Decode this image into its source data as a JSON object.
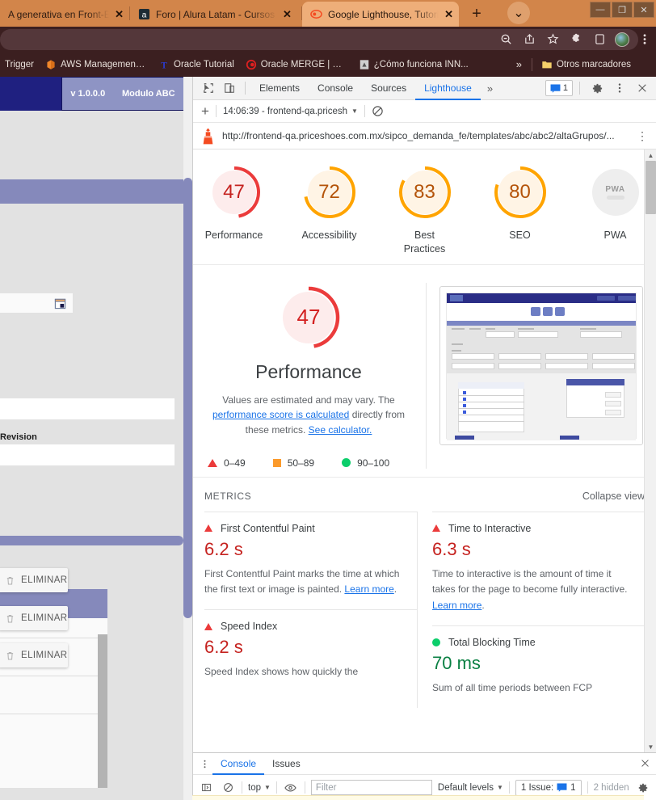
{
  "browser": {
    "tabs": [
      {
        "title": "A generativa en Front-End: tr",
        "icon": "none",
        "active": false
      },
      {
        "title": "Foro | Alura Latam - Cursos on",
        "icon": "alura-icon",
        "active": false
      },
      {
        "title": "Google Lighthouse, Tutorial Pa",
        "icon": "lighthouse-icon",
        "active": true
      }
    ],
    "new_tab_label": "+",
    "tab_search_label": "⌄",
    "window_controls": {
      "minimize": "—",
      "maximize": "❐",
      "close": "✕"
    },
    "toolbar_icons": [
      "zoom-out-icon",
      "share-icon",
      "bookmark-star-icon",
      "extensions-icon",
      "cast-icon",
      "profile-avatar",
      "chrome-menu-icon"
    ],
    "bookmarks": [
      {
        "label": "Trigger",
        "icon": "generic-icon"
      },
      {
        "label": "AWS Management Co...",
        "icon": "aws-icon"
      },
      {
        "label": "Oracle Tutorial",
        "icon": "oracle-t-icon"
      },
      {
        "label": "Oracle MERGE | How...",
        "icon": "oracle-icon"
      },
      {
        "label": "¿Cómo funciona INN...",
        "icon": "pdf-icon"
      }
    ],
    "bookmarks_overflow": "»",
    "other_bookmarks": "Otros marcadores"
  },
  "page": {
    "version": "v 1.0.0.0",
    "module": "Modulo ABC",
    "revision_label": "Revision",
    "delete_buttons": [
      "ELIMINAR",
      "ELIMINAR",
      "ELIMINAR"
    ]
  },
  "devtools": {
    "tabs": [
      {
        "label": "Elements",
        "selected": false
      },
      {
        "label": "Console",
        "selected": false
      },
      {
        "label": "Sources",
        "selected": false
      },
      {
        "label": "Lighthouse",
        "selected": true
      }
    ],
    "more_tabs": "»",
    "inspect_icon": "inspect-element-icon",
    "device_icon": "device-toolbar-icon",
    "issues_count": "1",
    "settings_icon": "gear-icon",
    "menu_icon": "kebab-menu-icon",
    "close_icon": "close-icon",
    "run_selector": "14:06:39 - frontend-qa.pricesh",
    "new_report_label": "+",
    "clear_icon": "clear-icon",
    "url": "http://frontend-qa.priceshoes.com.mx/sipco_demanda_fe/templates/abc/abc2/altaGrupos/...",
    "url_kebab": "⋮"
  },
  "lighthouse": {
    "categories": [
      {
        "label": "Performance",
        "score": 47,
        "color": "#eb3b3b",
        "track": "#fdecec"
      },
      {
        "label": "Accessibility",
        "score": 72,
        "color": "#ffa400",
        "track": "#fff4e5"
      },
      {
        "label": "Best Practices",
        "score": 83,
        "color": "#ffa400",
        "track": "#fff4e5"
      },
      {
        "label": "SEO",
        "score": 80,
        "color": "#ffa400",
        "track": "#fff4e5"
      },
      {
        "label": "PWA",
        "score": null,
        "color": "#e0e0e0",
        "track": "#eeeeee",
        "badge": "PWA"
      }
    ],
    "perf_panel": {
      "score": 47,
      "title": "Performance",
      "desc_part1": "Values are estimated and may vary. The ",
      "desc_link1": "performance score is calculated",
      "desc_part2": " directly from these metrics. ",
      "desc_link2": "See calculator."
    },
    "legend": [
      {
        "shape": "triangle",
        "label": "0–49",
        "color": "#eb3b3b"
      },
      {
        "shape": "square",
        "label": "50–89",
        "color": "#fb9a2b"
      },
      {
        "shape": "circle",
        "label": "90–100",
        "color": "#0cce6b"
      }
    ],
    "metrics_header": "METRICS",
    "collapse_label": "Collapse view",
    "metrics": [
      {
        "name": "First Contentful Paint",
        "value": "6.2 s",
        "status": "fail",
        "desc": "First Contentful Paint marks the time at which the first text or image is painted. ",
        "link": "Learn more",
        "tail": "."
      },
      {
        "name": "Time to Interactive",
        "value": "6.3 s",
        "status": "fail",
        "desc": "Time to interactive is the amount of time it takes for the page to become fully interactive. ",
        "link": "Learn more",
        "tail": "."
      },
      {
        "name": "Speed Index",
        "value": "6.2 s",
        "status": "fail",
        "desc": "Speed Index shows how quickly the",
        "link": "",
        "tail": ""
      },
      {
        "name": "Total Blocking Time",
        "value": "70 ms",
        "status": "pass",
        "desc": "Sum of all time periods between FCP",
        "link": "",
        "tail": ""
      }
    ]
  },
  "drawer": {
    "menu_icon": "kebab-menu-icon",
    "tabs": [
      {
        "label": "Console",
        "selected": true
      },
      {
        "label": "Issues",
        "selected": false
      }
    ],
    "close_icon": "close-icon",
    "sidebar_icon": "show-sidebar-icon",
    "clear_icon": "clear-console-icon",
    "context": "top",
    "eye_icon": "live-expression-icon",
    "filter_placeholder": "Filter",
    "levels": "Default levels",
    "issue_label": "1 Issue:",
    "issue_count": "1",
    "hidden_label": "2 hidden",
    "settings_icon": "gear-icon"
  }
}
